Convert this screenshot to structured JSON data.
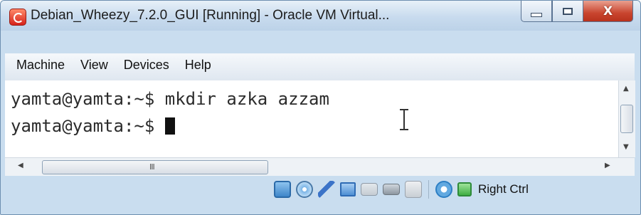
{
  "window": {
    "title": "Debian_Wheezy_7.2.0_GUI [Running] - Oracle VM Virtual...",
    "controls": {
      "minimize": "minimize",
      "maximize": "maximize",
      "close": "X"
    }
  },
  "menubar": {
    "items": [
      {
        "label": "Machine"
      },
      {
        "label": "View"
      },
      {
        "label": "Devices"
      },
      {
        "label": "Help"
      }
    ]
  },
  "terminal": {
    "lines": [
      {
        "text": "yamta@yamta:~$ mkdir azka azzam"
      },
      {
        "text": "yamta@yamta:~$ "
      }
    ]
  },
  "hscroll": {
    "grip": "III"
  },
  "statusbar": {
    "icons": [
      "hard-disk-icon",
      "optical-drive-icon",
      "usb-icon",
      "network-icon",
      "shared-folders-icon",
      "video-capture-icon",
      "recording-icon",
      "mouse-integration-icon",
      "keyboard-capture-icon"
    ],
    "host_key": "Right Ctrl"
  },
  "colors": {
    "frame": "#c9ddef",
    "terminal_bg": "#ffffff",
    "terminal_text": "#2b2b2b",
    "close_button": "#c9452f"
  }
}
